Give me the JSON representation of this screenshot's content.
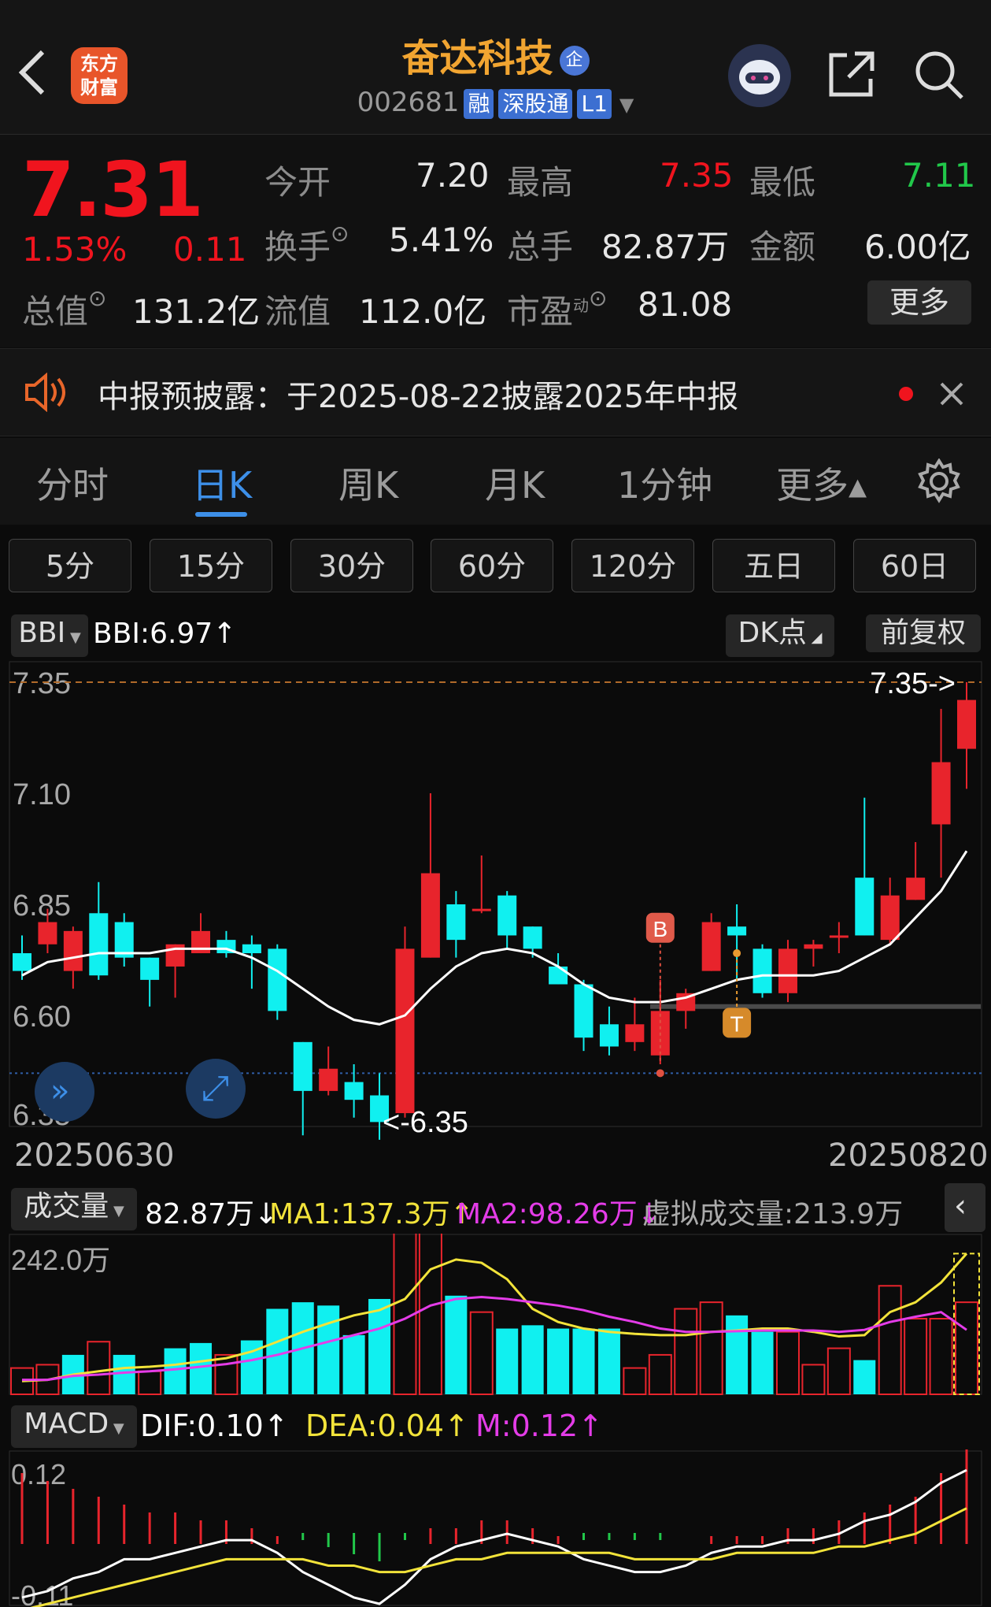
{
  "header": {
    "app_logo": "东方财富",
    "title": "奋达科技",
    "title_badge": "企",
    "code": "002681",
    "tags": [
      "融",
      "深股通",
      "L1"
    ],
    "icons": [
      "back-icon",
      "robot-avatar-icon",
      "share-icon",
      "search-icon"
    ]
  },
  "quote": {
    "price": "7.31",
    "change_pct": "1.53%",
    "change": "0.11",
    "open_label": "今开",
    "open": "7.20",
    "high_label": "最高",
    "high": "7.35",
    "low_label": "最低",
    "low": "7.11",
    "turnover_label": "换手",
    "turnover": "5.41%",
    "volume_label": "总手",
    "volume": "82.87万",
    "amount_label": "金额",
    "amount": "6.00亿",
    "mcap_label": "总值",
    "mcap": "131.2亿",
    "float_label": "流值",
    "float": "112.0亿",
    "pe_label": "市盈",
    "pe_sup": "动",
    "pe": "81.08",
    "more_label": "更多",
    "colors": {
      "up": "#f0141e",
      "down": "#21c84a"
    }
  },
  "notice": {
    "text": "中报预披露：于2025-08-22披露2025年中报"
  },
  "tabs": {
    "items": [
      "分时",
      "日K",
      "周K",
      "月K",
      "1分钟",
      "更多▴"
    ],
    "active": "日K"
  },
  "periods": [
    "5分",
    "15分",
    "30分",
    "60分",
    "120分",
    "五日",
    "60日"
  ],
  "kline": {
    "indicator": "BBI",
    "indicator_value": "BBI:6.97↑",
    "dk_label": "DK点",
    "adjust_label": "前复权",
    "y_ticks": [
      "7.35",
      "7.10",
      "6.85",
      "6.60",
      "6.35"
    ],
    "high_marker": "7.35->",
    "low_marker": "<-6.35",
    "date_start": "20250630",
    "date_end": "20250820",
    "buy_marker": "B",
    "sell_marker": "T"
  },
  "volume": {
    "indicator": "成交量",
    "value": "82.87万↓",
    "ma1": "MA1:137.3万↑",
    "ma2": "MA2:98.26万↓",
    "virtual": "虚拟成交量:213.9万",
    "max_label": "242.0万"
  },
  "macd": {
    "indicator": "MACD",
    "dif": "DIF:0.10↑",
    "dea": "DEA:0.04↑",
    "m": "M:0.12↑",
    "top_label": "0.12",
    "bottom_label": "-0.11"
  },
  "chart_data": {
    "type": "candlestick",
    "ylim": [
      6.35,
      7.35
    ],
    "candles": [
      {
        "o": 6.74,
        "c": 6.7,
        "h": 6.78,
        "l": 6.68
      },
      {
        "o": 6.76,
        "c": 6.81,
        "h": 6.84,
        "l": 6.74
      },
      {
        "o": 6.7,
        "c": 6.79,
        "h": 6.8,
        "l": 6.66
      },
      {
        "o": 6.83,
        "c": 6.69,
        "h": 6.9,
        "l": 6.68
      },
      {
        "o": 6.81,
        "c": 6.73,
        "h": 6.83,
        "l": 6.71
      },
      {
        "o": 6.73,
        "c": 6.68,
        "h": 6.73,
        "l": 6.62
      },
      {
        "o": 6.71,
        "c": 6.76,
        "h": 6.76,
        "l": 6.64
      },
      {
        "o": 6.74,
        "c": 6.79,
        "h": 6.83,
        "l": 6.74
      },
      {
        "o": 6.77,
        "c": 6.74,
        "h": 6.79,
        "l": 6.73
      },
      {
        "o": 6.76,
        "c": 6.74,
        "h": 6.78,
        "l": 6.66
      },
      {
        "o": 6.75,
        "c": 6.61,
        "h": 6.76,
        "l": 6.59
      },
      {
        "o": 6.54,
        "c": 6.43,
        "h": 6.54,
        "l": 6.33
      },
      {
        "o": 6.43,
        "c": 6.48,
        "h": 6.53,
        "l": 6.42
      },
      {
        "o": 6.45,
        "c": 6.41,
        "h": 6.49,
        "l": 6.37
      },
      {
        "o": 6.42,
        "c": 6.36,
        "h": 6.47,
        "l": 6.32
      },
      {
        "o": 6.38,
        "c": 6.75,
        "h": 6.8,
        "l": 6.37
      },
      {
        "o": 6.73,
        "c": 6.92,
        "h": 7.1,
        "l": 6.73
      },
      {
        "o": 6.85,
        "c": 6.77,
        "h": 6.88,
        "l": 6.73
      },
      {
        "o": 6.84,
        "c": 6.84,
        "h": 6.96,
        "l": 6.83
      },
      {
        "o": 6.87,
        "c": 6.78,
        "h": 6.88,
        "l": 6.75
      },
      {
        "o": 6.8,
        "c": 6.75,
        "h": 6.8,
        "l": 6.73
      },
      {
        "o": 6.71,
        "c": 6.67,
        "h": 6.74,
        "l": 6.67
      },
      {
        "o": 6.67,
        "c": 6.55,
        "h": 6.68,
        "l": 6.52
      },
      {
        "o": 6.58,
        "c": 6.53,
        "h": 6.62,
        "l": 6.51
      },
      {
        "o": 6.54,
        "c": 6.58,
        "h": 6.64,
        "l": 6.52
      },
      {
        "o": 6.51,
        "c": 6.61,
        "h": 6.68,
        "l": 6.49
      },
      {
        "o": 6.61,
        "c": 6.65,
        "h": 6.66,
        "l": 6.57
      },
      {
        "o": 6.7,
        "c": 6.81,
        "h": 6.83,
        "l": 6.7
      },
      {
        "o": 6.8,
        "c": 6.78,
        "h": 6.85,
        "l": 6.68
      },
      {
        "o": 6.75,
        "c": 6.65,
        "h": 6.76,
        "l": 6.64
      },
      {
        "o": 6.65,
        "c": 6.75,
        "h": 6.77,
        "l": 6.63
      },
      {
        "o": 6.75,
        "c": 6.76,
        "h": 6.77,
        "l": 6.71
      },
      {
        "o": 6.78,
        "c": 6.78,
        "h": 6.81,
        "l": 6.74
      },
      {
        "o": 6.91,
        "c": 6.78,
        "h": 7.09,
        "l": 6.78
      },
      {
        "o": 6.77,
        "c": 6.87,
        "h": 6.91,
        "l": 6.76
      },
      {
        "o": 6.86,
        "c": 6.91,
        "h": 6.99,
        "l": 6.86
      },
      {
        "o": 7.03,
        "c": 7.17,
        "h": 7.29,
        "l": 6.91
      },
      {
        "o": 7.2,
        "c": 7.31,
        "h": 7.35,
        "l": 7.11
      }
    ],
    "bbi": [
      6.69,
      6.72,
      6.73,
      6.74,
      6.74,
      6.74,
      6.75,
      6.75,
      6.75,
      6.73,
      6.7,
      6.66,
      6.62,
      6.59,
      6.58,
      6.6,
      6.66,
      6.71,
      6.74,
      6.75,
      6.74,
      6.71,
      6.67,
      6.64,
      6.63,
      6.63,
      6.64,
      6.66,
      6.68,
      6.69,
      6.69,
      6.69,
      6.7,
      6.73,
      6.76,
      6.82,
      6.88,
      6.97
    ],
    "volume": [
      40,
      45,
      60,
      80,
      60,
      35,
      70,
      78,
      60,
      82,
      130,
      140,
      135,
      90,
      145,
      250,
      247,
      150,
      125,
      100,
      105,
      100,
      100,
      100,
      40,
      60,
      130,
      140,
      120,
      95,
      95,
      45,
      70,
      52,
      165,
      115,
      115,
      140
    ],
    "volume_up": [
      true,
      true,
      false,
      true,
      false,
      true,
      false,
      false,
      true,
      false,
      false,
      false,
      false,
      false,
      false,
      true,
      true,
      false,
      true,
      false,
      false,
      false,
      false,
      false,
      true,
      true,
      true,
      true,
      false,
      false,
      true,
      true,
      true,
      false,
      true,
      true,
      true,
      true
    ],
    "vol_ma1": [
      20,
      22,
      30,
      35,
      40,
      42,
      45,
      50,
      55,
      65,
      80,
      95,
      108,
      120,
      128,
      145,
      190,
      205,
      200,
      175,
      130,
      110,
      100,
      95,
      92,
      90,
      90,
      95,
      97,
      100,
      100,
      95,
      88,
      90,
      125,
      140,
      170,
      214
    ],
    "vol_ma2": [
      22,
      22,
      28,
      30,
      33,
      35,
      38,
      42,
      46,
      52,
      60,
      70,
      80,
      90,
      100,
      115,
      135,
      145,
      148,
      145,
      140,
      135,
      128,
      118,
      110,
      100,
      95,
      95,
      96,
      97,
      97,
      97,
      95,
      98,
      110,
      118,
      125,
      98
    ],
    "macd_hist": [
      0.09,
      0.08,
      0.07,
      0.06,
      0.05,
      0.04,
      0.04,
      0.03,
      0.03,
      0.02,
      0.01,
      -0.01,
      -0.02,
      -0.03,
      -0.04,
      -0.01,
      0.02,
      0.02,
      0.03,
      0.03,
      0.02,
      0.01,
      -0.01,
      -0.01,
      -0.01,
      -0.01,
      0.0,
      0.01,
      0.01,
      0.01,
      0.02,
      0.02,
      0.03,
      0.04,
      0.05,
      0.06,
      0.09,
      0.12
    ],
    "dif": [
      -0.1,
      -0.09,
      -0.07,
      -0.06,
      -0.04,
      -0.04,
      -0.03,
      -0.02,
      -0.01,
      -0.01,
      -0.03,
      -0.06,
      -0.08,
      -0.1,
      -0.11,
      -0.08,
      -0.04,
      -0.02,
      -0.01,
      0.0,
      -0.01,
      -0.02,
      -0.04,
      -0.05,
      -0.06,
      -0.06,
      -0.05,
      -0.03,
      -0.02,
      -0.02,
      -0.01,
      -0.01,
      0.0,
      0.02,
      0.03,
      0.05,
      0.08,
      0.1
    ],
    "dea": [
      -0.12,
      -0.11,
      -0.1,
      -0.09,
      -0.08,
      -0.07,
      -0.06,
      -0.05,
      -0.04,
      -0.04,
      -0.04,
      -0.04,
      -0.05,
      -0.05,
      -0.06,
      -0.06,
      -0.05,
      -0.04,
      -0.04,
      -0.03,
      -0.03,
      -0.03,
      -0.03,
      -0.03,
      -0.04,
      -0.04,
      -0.04,
      -0.04,
      -0.03,
      -0.03,
      -0.03,
      -0.03,
      -0.02,
      -0.02,
      -0.01,
      0.0,
      0.02,
      0.04
    ]
  }
}
